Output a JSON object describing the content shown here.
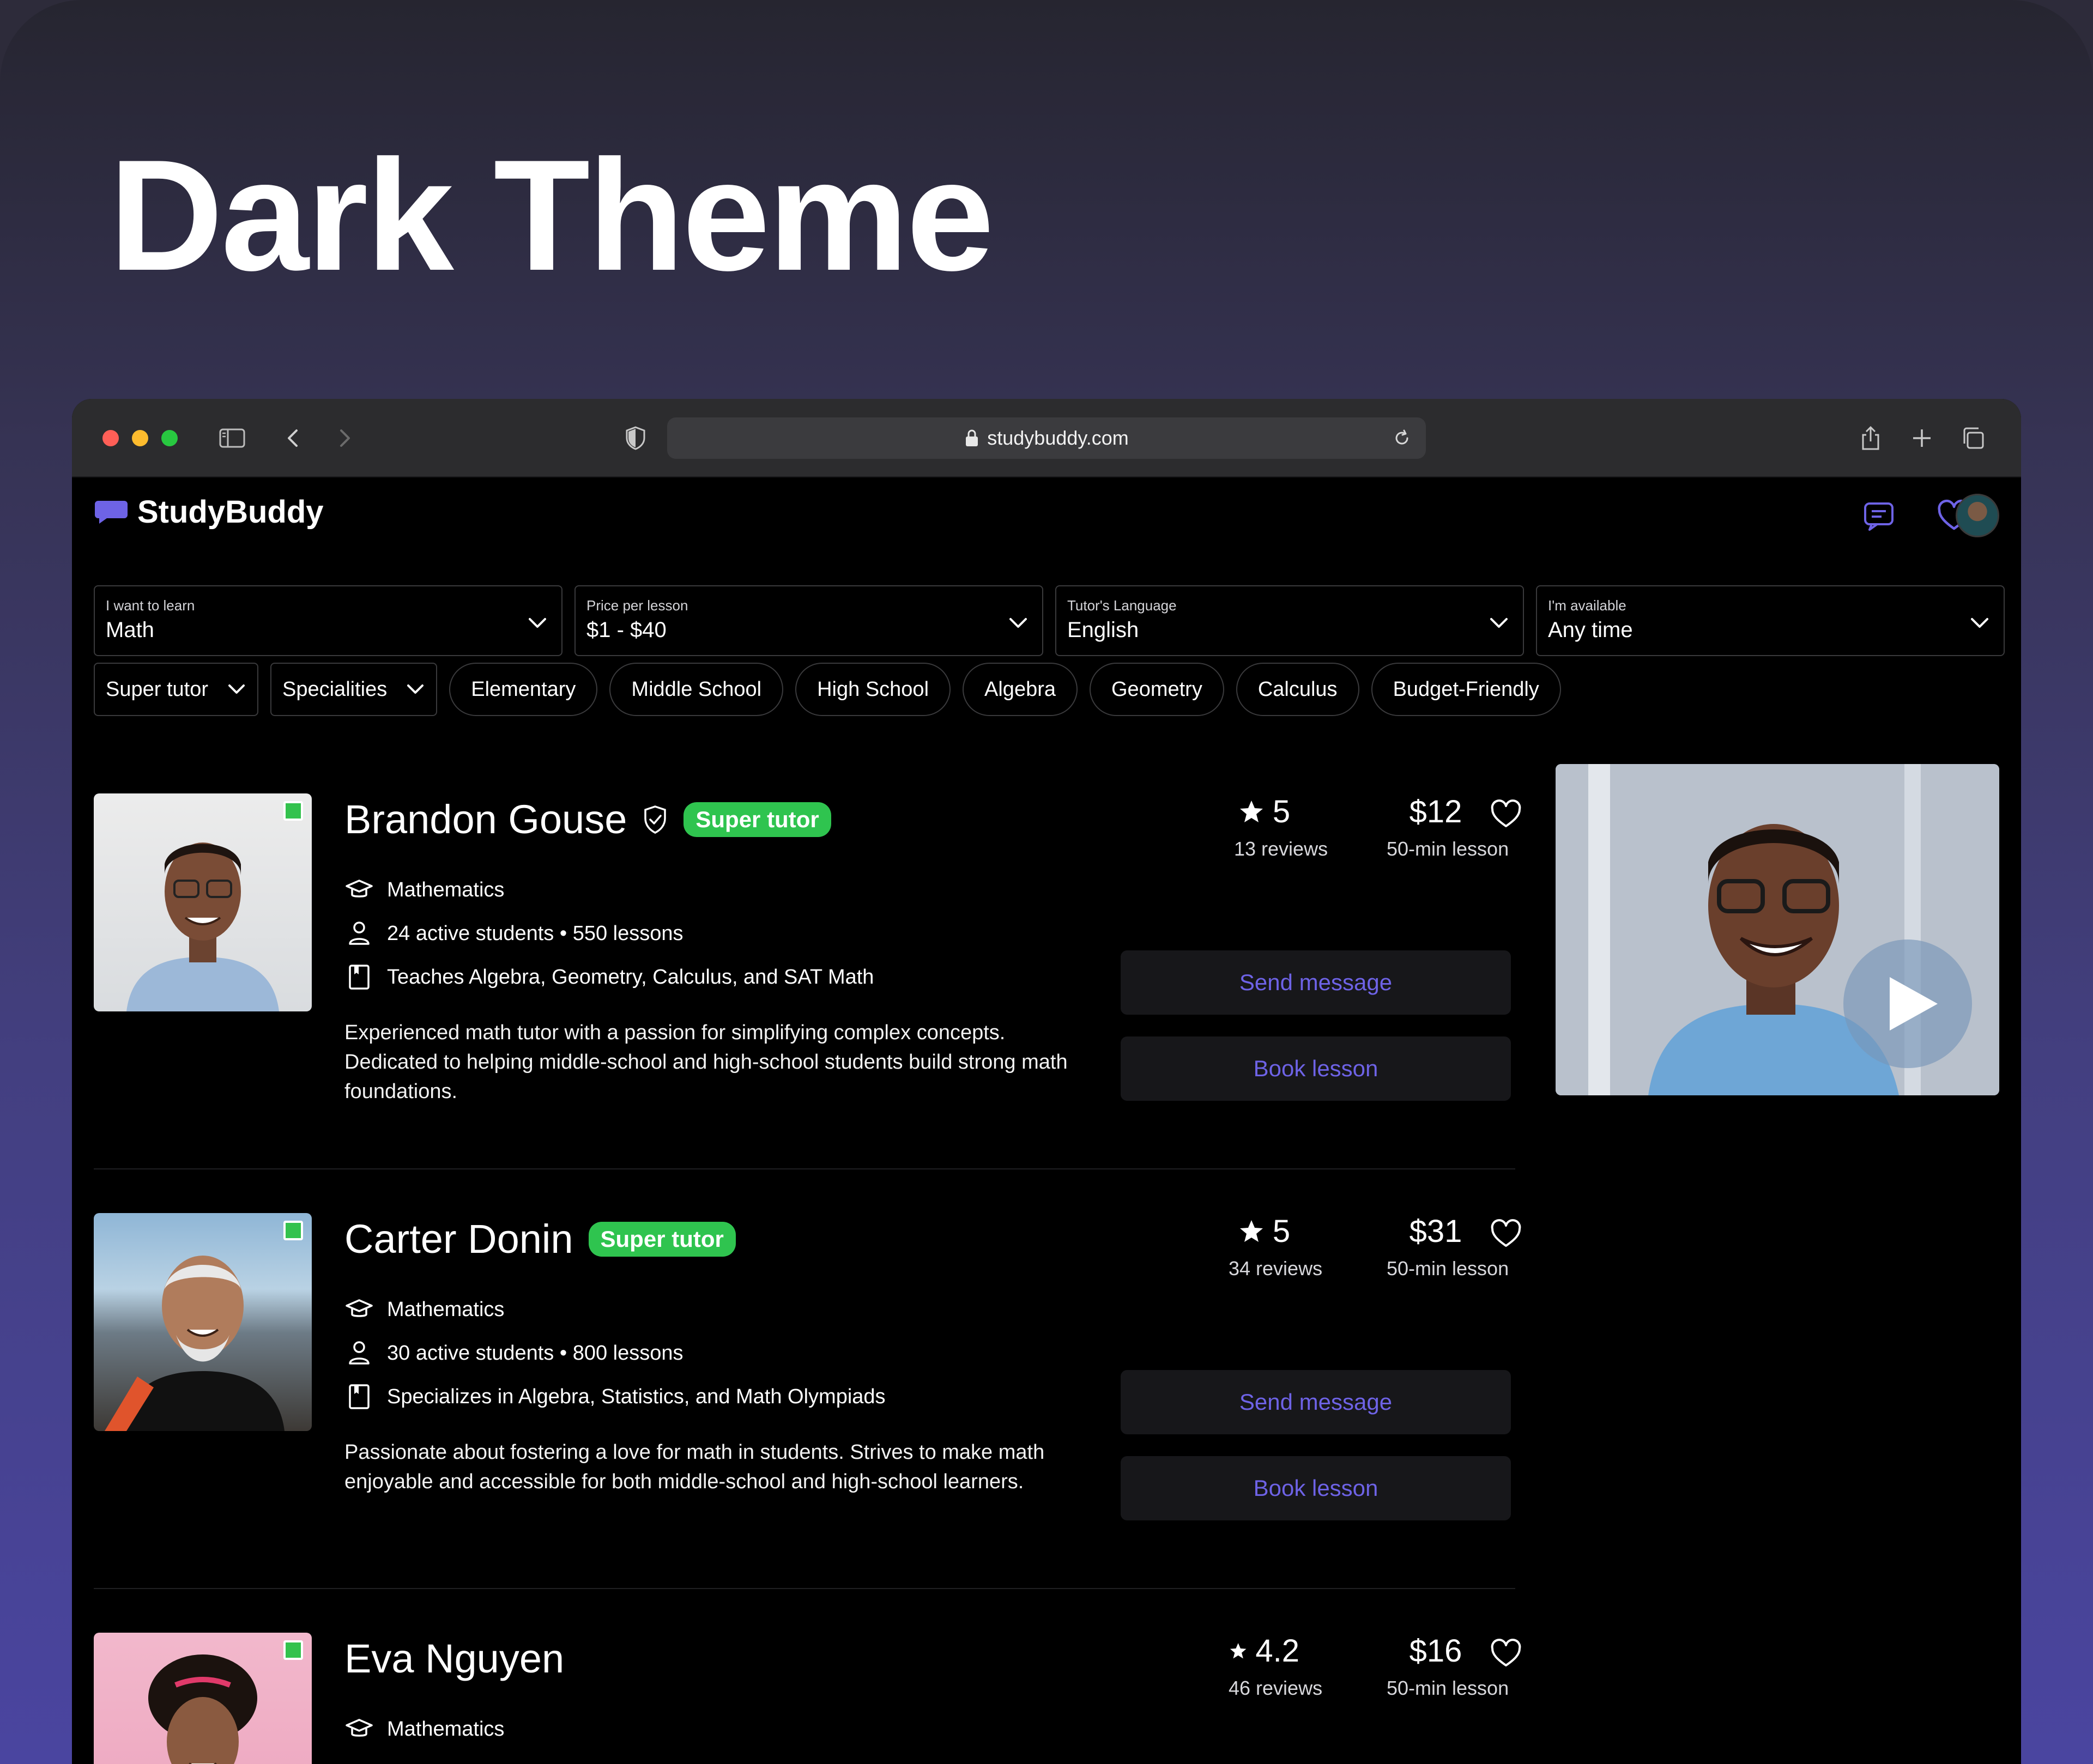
{
  "hero": {
    "title": "Dark Theme"
  },
  "browser": {
    "url": "studybuddy.com"
  },
  "site": {
    "brand": "StudyBuddy",
    "accent": "#6e63e6",
    "badge_color": "#2fc44f"
  },
  "filters": [
    {
      "label": "I want to learn",
      "value": "Math"
    },
    {
      "label": "Price per lesson",
      "value": "$1 - $40"
    },
    {
      "label": "Tutor's Language",
      "value": "English"
    },
    {
      "label": "I'm available",
      "value": "Any time"
    }
  ],
  "chips": {
    "dropdowns": [
      "Super tutor",
      "Specialities"
    ],
    "tags": [
      "Elementary",
      "Middle School",
      "High School",
      "Algebra",
      "Geometry",
      "Calculus",
      "Budget-Friendly"
    ]
  },
  "tutors": [
    {
      "name": "Brandon Gouse",
      "super_badge": "Super tutor",
      "subject": "Mathematics",
      "students": "24 active students • 550 lessons",
      "teaches": "Teaches Algebra, Geometry, Calculus, and SAT Math",
      "description": "Experienced math tutor with a passion for simplifying complex concepts. Dedicated to helping middle-school and high-school students build strong math foundations.",
      "rating": "5",
      "reviews": "13 reviews",
      "price": "$12",
      "duration": "50-min lesson",
      "send_label": "Send message",
      "book_label": "Book lesson"
    },
    {
      "name": "Carter Donin",
      "super_badge": "Super tutor",
      "subject": "Mathematics",
      "students": "30 active students • 800 lessons",
      "teaches": "Specializes in Algebra, Statistics, and Math Olympiads",
      "description": "Passionate about fostering a love for math in students. Strives to make math enjoyable and accessible for both middle-school and high-school learners.",
      "rating": "5",
      "reviews": "34 reviews",
      "price": "$31",
      "duration": "50-min lesson",
      "send_label": "Send message",
      "book_label": "Book lesson"
    },
    {
      "name": "Eva Nguyen",
      "subject": "Mathematics",
      "rating": "4.2",
      "reviews": "46 reviews",
      "price": "$16",
      "duration": "50-min lesson"
    }
  ]
}
